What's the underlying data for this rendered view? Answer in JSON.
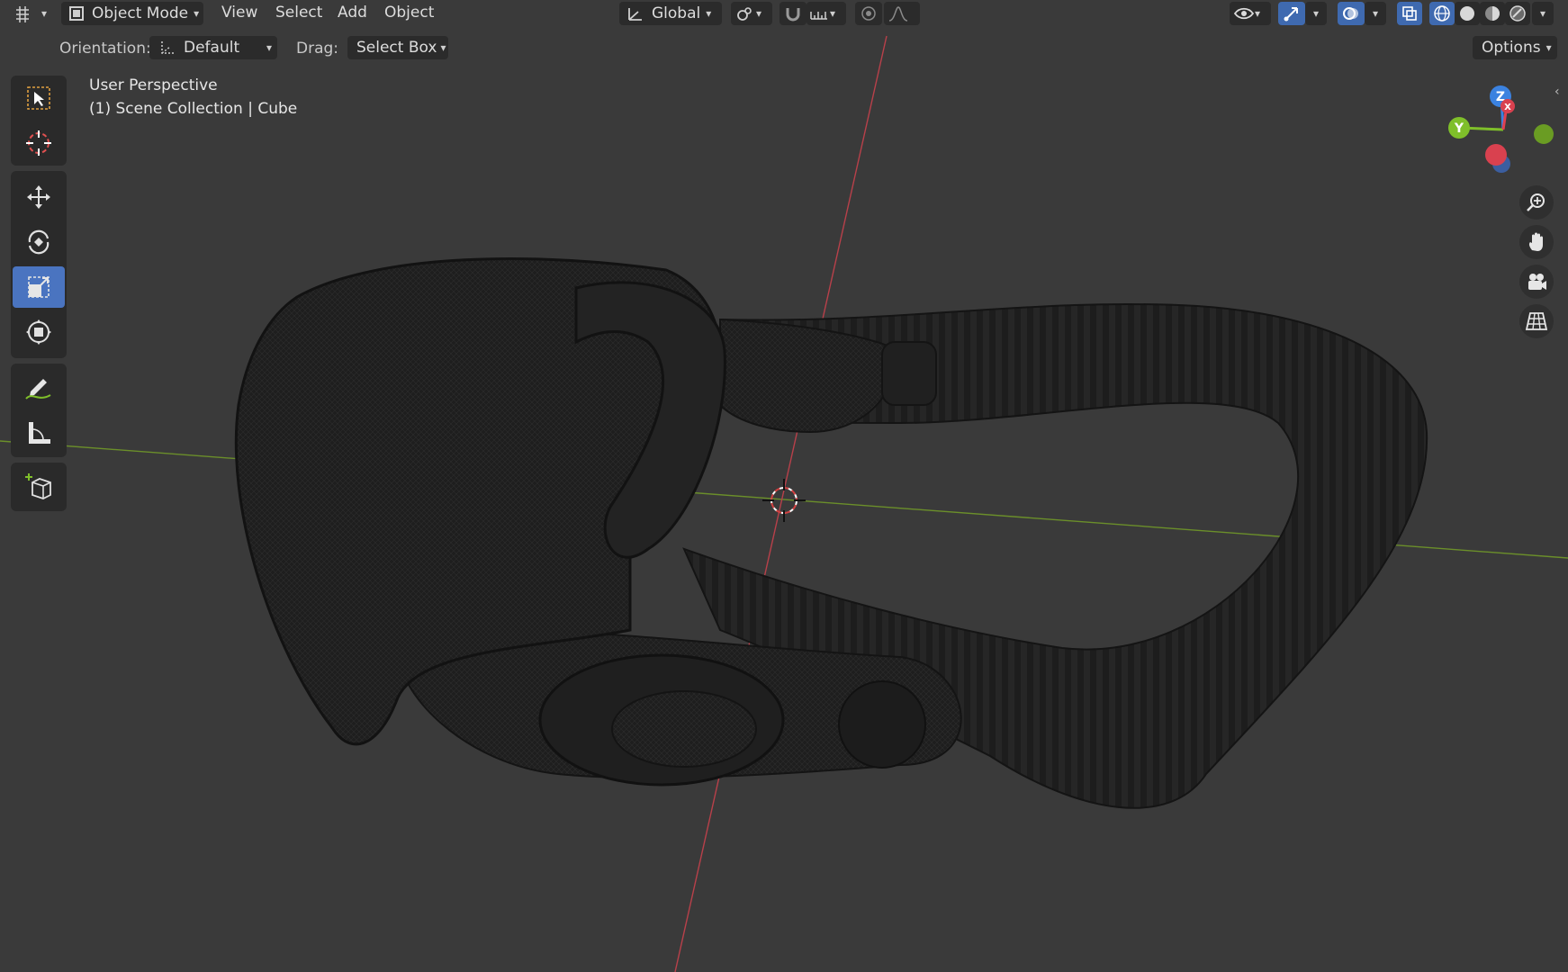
{
  "header": {
    "editor_type": "3D Viewport",
    "mode_label": "Object Mode",
    "menus": [
      "View",
      "Select",
      "Add",
      "Object"
    ],
    "transform_orientation": "Global"
  },
  "tool_settings": {
    "orientation_label": "Orientation:",
    "orientation_value": "Default",
    "drag_label": "Drag:",
    "drag_value": "Select Box",
    "options_label": "Options"
  },
  "viewport": {
    "view_name": "User Perspective",
    "collection_info": "(1) Scene Collection | Cube"
  },
  "gizmo": {
    "axes": [
      "Z",
      "Y",
      "X"
    ],
    "colors": {
      "x": "#e04050",
      "y": "#7fbf2a",
      "z": "#3b82e0"
    }
  },
  "toolbar": {
    "tools": [
      "select-box",
      "cursor",
      "move",
      "rotate",
      "scale",
      "transform",
      "annotate",
      "measure",
      "add-cube"
    ],
    "active_tool": "scale"
  },
  "colors": {
    "accent": "#4a74c0",
    "background": "#3a3a3a",
    "panel": "#2a2a2a"
  }
}
